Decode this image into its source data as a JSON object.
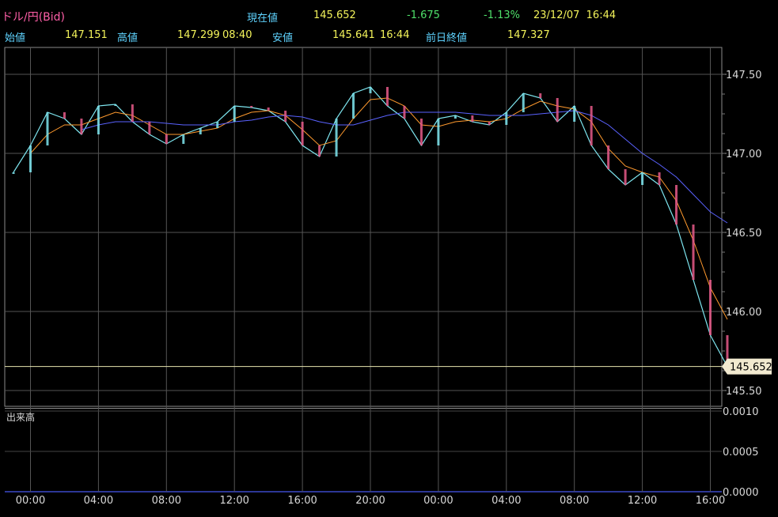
{
  "header": {
    "symbol": "ドル/円(Bid)",
    "current_label": "現在値",
    "current_value": "145.652",
    "change": "-1.675",
    "change_pct": "-1.13%",
    "datetime": "23/12/07  16:44",
    "open_label": "始値",
    "open_value": "147.151",
    "high_label": "高値",
    "high_value": "147.299",
    "high_time": "08:40",
    "low_label": "安値",
    "low_value": "145.641",
    "low_time": "16:44",
    "prev_close_label": "前日終値",
    "prev_close_value": "147.327"
  },
  "volume_label": "出来高",
  "current_price_tag": "145.652",
  "chart_data": [
    {
      "type": "line",
      "x": [
        "23:00",
        "00:00",
        "01:00",
        "02:00",
        "03:00",
        "04:00",
        "05:00",
        "06:00",
        "07:00",
        "08:00",
        "09:00",
        "10:00",
        "11:00",
        "12:00",
        "13:00",
        "14:00",
        "15:00",
        "16:00",
        "17:00",
        "18:00",
        "19:00",
        "20:00",
        "21:00",
        "22:00",
        "23:00",
        "00:00",
        "01:00",
        "02:00",
        "03:00",
        "04:00",
        "05:00",
        "06:00",
        "07:00",
        "08:00",
        "09:00",
        "10:00",
        "11:00",
        "12:00",
        "13:00",
        "14:00",
        "15:00",
        "16:00",
        "16:44"
      ],
      "x_ticks": [
        "00:00",
        "04:00",
        "08:00",
        "12:00",
        "16:00",
        "20:00",
        "00:00",
        "04:00",
        "08:00",
        "12:00",
        "16:00"
      ],
      "y_ticks": [
        "145.50",
        "146.00",
        "146.50",
        "147.00",
        "147.50"
      ],
      "ylim": [
        145.4,
        147.67
      ],
      "series": [
        {
          "values": [
            146.88,
            147.05,
            147.26,
            147.22,
            147.12,
            147.3,
            147.31,
            147.2,
            147.12,
            147.06,
            147.12,
            147.16,
            147.2,
            147.3,
            147.29,
            147.27,
            147.2,
            147.05,
            146.98,
            147.22,
            147.38,
            147.42,
            147.3,
            147.22,
            147.05,
            147.22,
            147.24,
            147.2,
            147.18,
            147.26,
            147.38,
            147.35,
            147.2,
            147.3,
            147.05,
            146.9,
            146.8,
            146.88,
            146.8,
            146.55,
            146.2,
            145.85,
            145.652
          ]
        },
        {
          "values": [
            null,
            147.0,
            147.12,
            147.18,
            147.18,
            147.22,
            147.26,
            147.24,
            147.18,
            147.12,
            147.12,
            147.14,
            147.16,
            147.22,
            147.26,
            147.27,
            147.24,
            147.15,
            147.05,
            147.08,
            147.22,
            147.34,
            147.35,
            147.3,
            147.18,
            147.17,
            147.2,
            147.21,
            147.2,
            147.22,
            147.28,
            147.33,
            147.3,
            147.28,
            147.2,
            147.03,
            146.92,
            146.88,
            146.85,
            146.7,
            146.45,
            146.15,
            145.95
          ]
        },
        {
          "values": [
            null,
            null,
            null,
            null,
            147.15,
            147.18,
            147.2,
            147.2,
            147.2,
            147.19,
            147.18,
            147.18,
            147.18,
            147.2,
            147.21,
            147.23,
            147.24,
            147.23,
            147.2,
            147.18,
            147.18,
            147.21,
            147.24,
            147.26,
            147.26,
            147.26,
            147.26,
            147.25,
            147.24,
            147.24,
            147.24,
            147.25,
            147.26,
            147.27,
            147.24,
            147.18,
            147.09,
            147.0,
            146.93,
            146.85,
            146.74,
            146.63,
            146.56
          ]
        }
      ]
    },
    {
      "type": "bar",
      "y_ticks": [
        "0.0000",
        "0.0005",
        "0.0010"
      ],
      "ylim": [
        0,
        0.001
      ]
    }
  ]
}
